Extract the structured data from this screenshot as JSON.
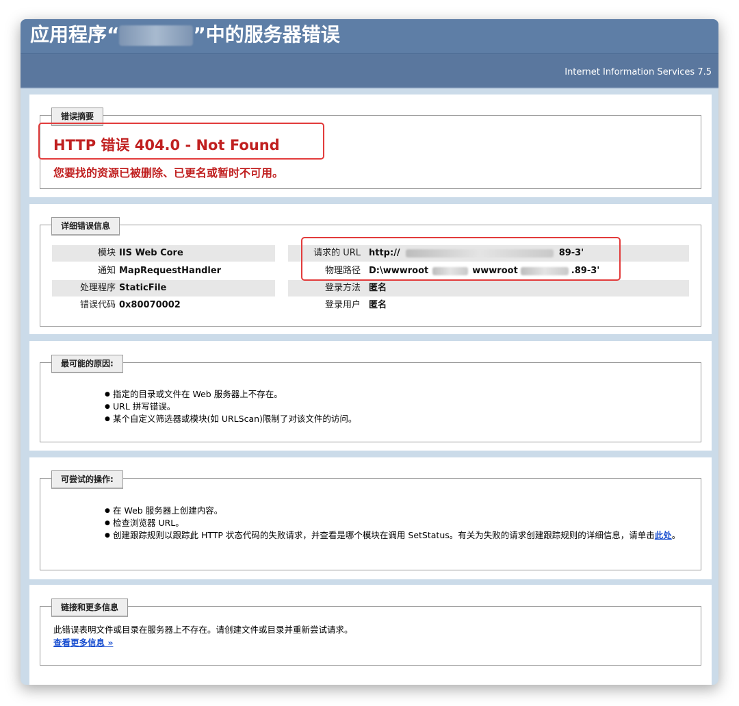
{
  "title": {
    "prefix": "应用程序“",
    "redacted": "",
    "suffix": "”中的服务器错误"
  },
  "subheader": "Internet Information Services 7.5",
  "summary": {
    "legend": "错误摘要",
    "error_title": "HTTP 错误 404.0 - Not Found",
    "error_message": "您要找的资源已被删除、已更名或暂时不可用。"
  },
  "details": {
    "legend": "详细错误信息",
    "left": [
      {
        "label": "模块",
        "value": "IIS Web Core"
      },
      {
        "label": "通知",
        "value": "MapRequestHandler"
      },
      {
        "label": "处理程序",
        "value": "StaticFile"
      },
      {
        "label": "错误代码",
        "value": "0x80070002"
      }
    ],
    "right": [
      {
        "label": "请求的 URL",
        "value_start": "http://",
        "value_end": "89-3'"
      },
      {
        "label": "物理路径",
        "value_start": "D:\\wwwroot",
        "value_mid": "wwwroot",
        "value_end": ".89-3'"
      },
      {
        "label": "登录方法",
        "value": "匿名"
      },
      {
        "label": "登录用户",
        "value": "匿名"
      }
    ]
  },
  "causes": {
    "legend": "最可能的原因:",
    "items": [
      "指定的目录或文件在 Web 服务器上不存在。",
      "URL 拼写错误。",
      "某个自定义筛选器或模块(如 URLScan)限制了对该文件的访问。"
    ]
  },
  "actions": {
    "legend": "可尝试的操作:",
    "items": [
      "在 Web 服务器上创建内容。",
      "检查浏览器 URL。"
    ],
    "item3_text": "创建跟踪规则以跟踪此 HTTP 状态代码的失败请求，并查看是哪个模块在调用 SetStatus。有关为失败的请求创建跟踪规则的详细信息，请单击",
    "item3_link": "此处",
    "item3_end": "。"
  },
  "links": {
    "legend": "链接和更多信息",
    "text": "此错误表明文件或目录在服务器上不存在。请创建文件或目录并重新尝试请求。",
    "more_link": "查看更多信息 »"
  },
  "colors": {
    "header_bg": "#5e7ea6",
    "page_bg": "#cbdbe9",
    "error_red": "#c02020",
    "annotation_red": "#e23b3b"
  }
}
